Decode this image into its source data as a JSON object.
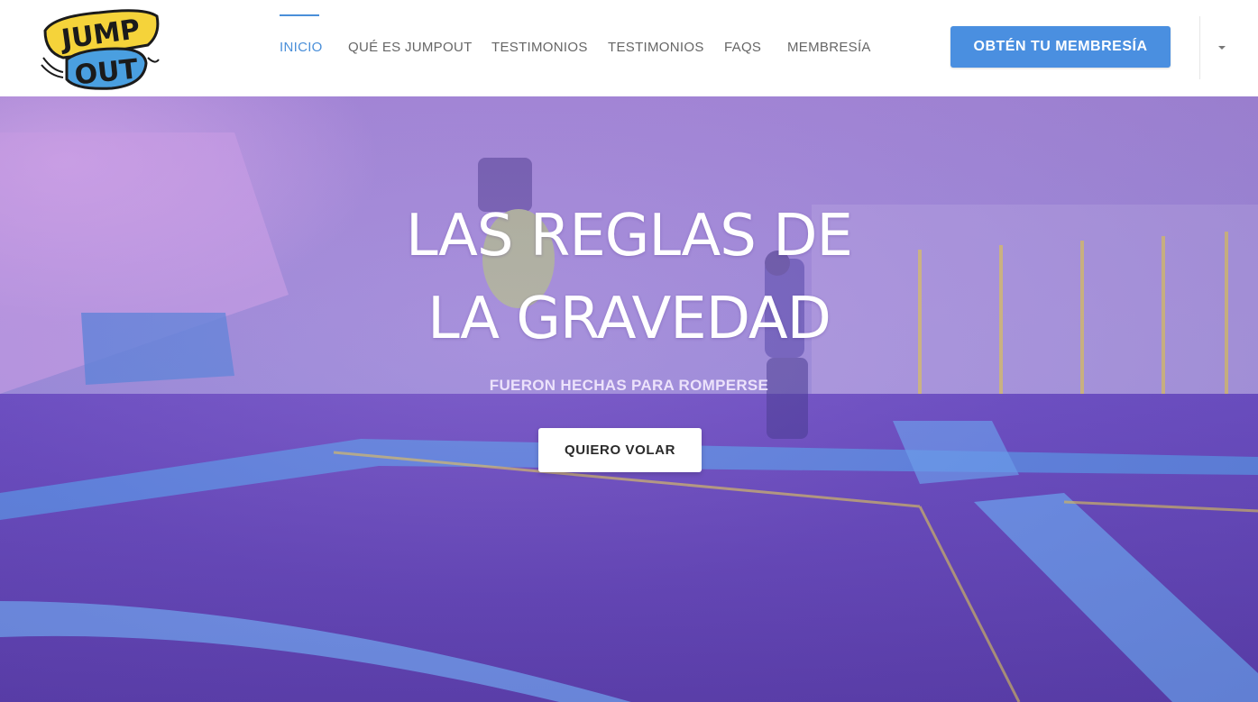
{
  "brand": {
    "logo_text_top": "JUMP",
    "logo_text_bottom": "OUT",
    "logo_yellow": "#f5d33a",
    "logo_blue": "#4a9fe0",
    "logo_dark": "#1b1b1b"
  },
  "nav": {
    "items": [
      {
        "label": "INICIO",
        "active": true
      },
      {
        "label": "QUÉ ES JUMPOUT",
        "active": false
      },
      {
        "label": "TESTIMONIOS",
        "active": false
      },
      {
        "label": "TESTIMONIOS",
        "active": false
      },
      {
        "label": "FAQS",
        "active": false
      },
      {
        "label": "MEMBRESÍA",
        "active": false
      }
    ],
    "active_color": "#4a8fd9",
    "text_color": "#666666"
  },
  "header_cta": {
    "label": "OBTÉN TU MEMBRESÍA",
    "color": "#4a8fe0"
  },
  "dropdown": {
    "icon": "caret-down-icon"
  },
  "hero": {
    "title_line1": "LAS REGLAS DE",
    "title_line2": "LA GRAVEDAD",
    "subtitle": "FUERON HECHAS PARA ROMPERSE",
    "button_label": "QUIERO VOLAR",
    "tint_color": "#7a64c4"
  }
}
